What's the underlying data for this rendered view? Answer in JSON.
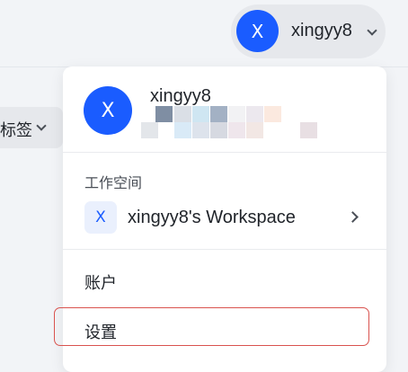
{
  "header": {
    "user_button": {
      "avatar_letter": "X",
      "username": "xingyy8"
    }
  },
  "background": {
    "tag_filter_label": "标签"
  },
  "dropdown": {
    "avatar_letter": "X",
    "username": "xingyy8",
    "workspace_section_label": "工作空间",
    "workspace": {
      "icon_letter": "X",
      "name": "xingyy8's Workspace"
    },
    "menu": {
      "account_label": "账户",
      "settings_label": "设置"
    }
  },
  "colors": {
    "accent": "#1a5cff",
    "highlight_border": "#d9534f"
  },
  "icons": {
    "user_button_chevron": "chevron-down-icon",
    "tag_chevron": "chevron-down-icon",
    "workspace_chevron": "chevron-right-icon"
  }
}
